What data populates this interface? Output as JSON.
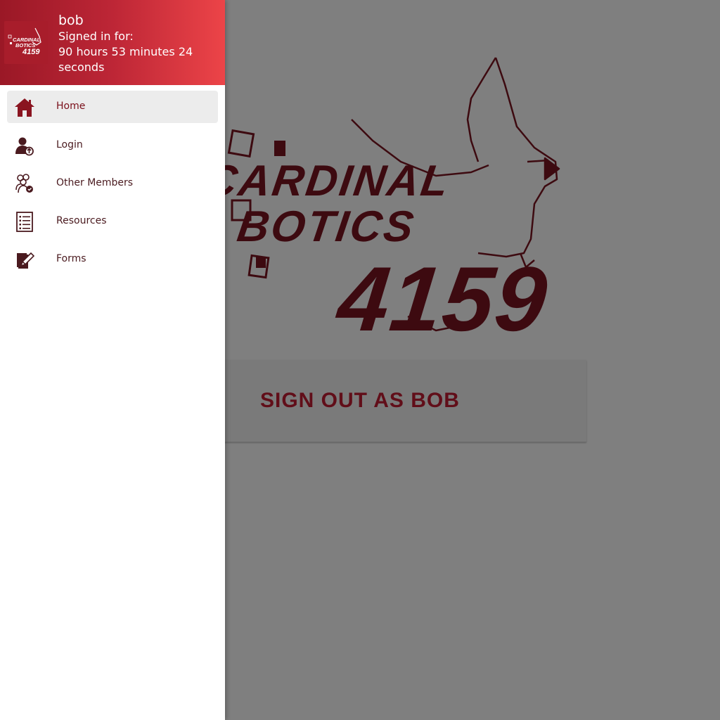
{
  "user": {
    "name": "bob",
    "signed_in_label": "Signed in for:",
    "signed_in_duration": "90 hours 53 minutes 24 seconds"
  },
  "avatar_logo": {
    "line1": "CARDINAL",
    "line2": "BOTICS",
    "number": "4159"
  },
  "nav": {
    "items": [
      {
        "label": "Home",
        "icon": "home-icon",
        "active": true
      },
      {
        "label": "Login",
        "icon": "login-icon",
        "active": false
      },
      {
        "label": "Other Members",
        "icon": "members-icon",
        "active": false
      },
      {
        "label": "Resources",
        "icon": "resources-icon",
        "active": false
      },
      {
        "label": "Forms",
        "icon": "forms-icon",
        "active": false
      }
    ]
  },
  "main": {
    "logo": {
      "line1": "CARDINAL",
      "line2": "BOTICS",
      "number": "4159"
    },
    "signout_label": "SIGN OUT AS BOB"
  },
  "colors": {
    "brand": "#9a1826",
    "accent": "#c21d32",
    "header_gradient_end": "#ec4448",
    "active_item_bg": "#ececec"
  }
}
